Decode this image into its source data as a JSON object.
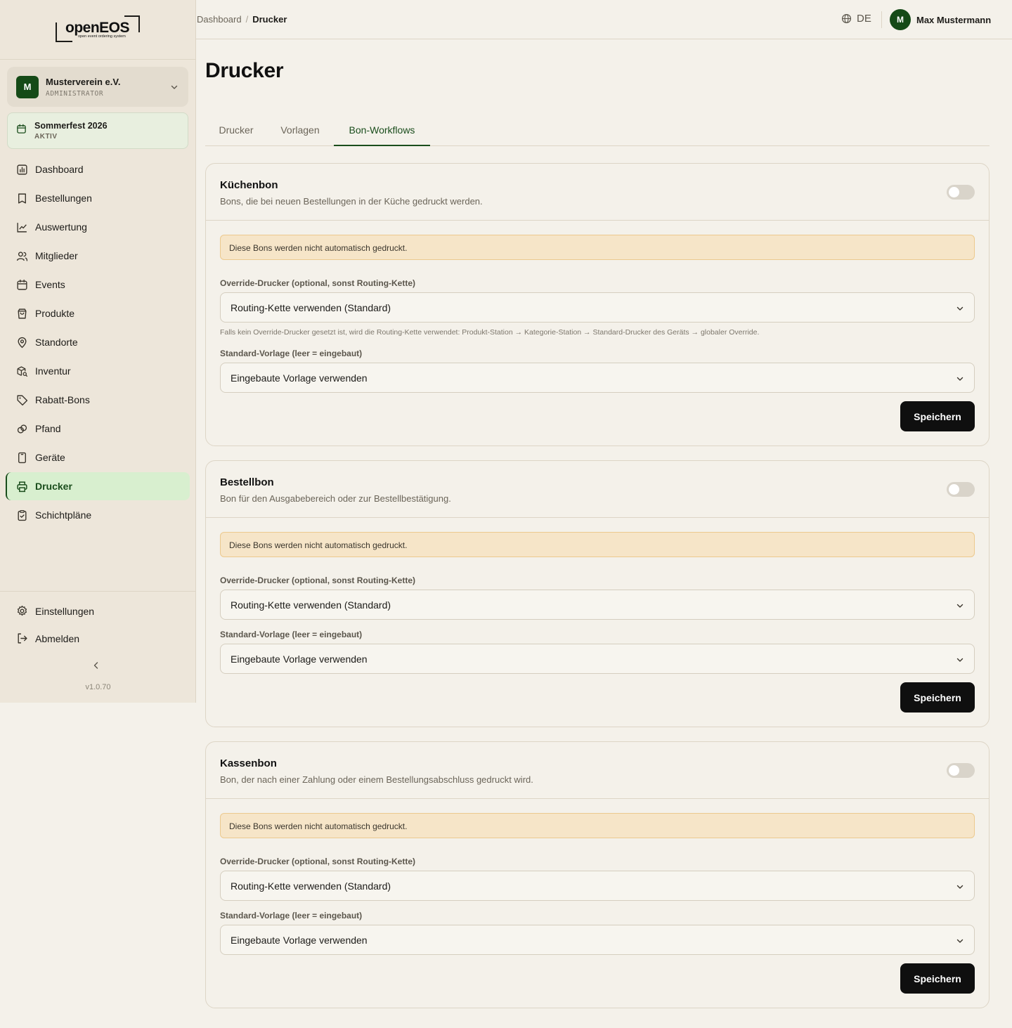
{
  "sidebar": {
    "brand": "openEOS",
    "brand_tagline": "open event ordering system",
    "org": {
      "initial": "M",
      "name": "Musterverein e.V.",
      "role": "ADMINISTRATOR"
    },
    "event": {
      "name": "Sommerfest 2026",
      "status": "AKTIV"
    },
    "items": [
      {
        "label": "Dashboard",
        "icon": "dashboard-icon"
      },
      {
        "label": "Bestellungen",
        "icon": "receipt-icon"
      },
      {
        "label": "Auswertung",
        "icon": "chart-line-icon"
      },
      {
        "label": "Mitglieder",
        "icon": "users-icon"
      },
      {
        "label": "Events",
        "icon": "calendar-icon"
      },
      {
        "label": "Produkte",
        "icon": "shopping-bag-icon"
      },
      {
        "label": "Standorte",
        "icon": "map-pin-icon"
      },
      {
        "label": "Inventur",
        "icon": "package-search-icon"
      },
      {
        "label": "Rabatt-Bons",
        "icon": "tag-icon"
      },
      {
        "label": "Pfand",
        "icon": "link-icon"
      },
      {
        "label": "Geräte",
        "icon": "tablet-icon"
      },
      {
        "label": "Drucker",
        "icon": "printer-icon",
        "active": true
      },
      {
        "label": "Schichtpläne",
        "icon": "clipboard-check-icon"
      }
    ],
    "settings_label": "Einstellungen",
    "logout_label": "Abmelden",
    "version": "v1.0.70"
  },
  "topbar": {
    "breadcrumb_root": "Dashboard",
    "breadcrumb_sep": "/",
    "breadcrumb_current": "Drucker",
    "language": "DE",
    "user_initial": "M",
    "user_name": "Max Mustermann"
  },
  "main": {
    "title": "Drucker",
    "tabs": [
      "Drucker",
      "Vorlagen",
      "Bon-Workflows"
    ],
    "active_tab": "Bon-Workflows",
    "cards": [
      {
        "title": "Küchenbon",
        "description": "Bons, die bei neuen Bestellungen in der Küche gedruckt werden.",
        "enabled": false,
        "notice": "Diese Bons werden nicht automatisch gedruckt.",
        "override_label": "Override-Drucker (optional, sonst Routing-Kette)",
        "override_value": "Routing-Kette verwenden (Standard)",
        "hint": "Falls kein Override-Drucker gesetzt ist, wird die Routing-Kette verwendet: Produkt-Station → Kategorie-Station → Standard-Drucker des Geräts → globaler Override.",
        "template_label": "Standard-Vorlage (leer = eingebaut)",
        "template_value": "Eingebaute Vorlage verwenden",
        "save_label": "Speichern"
      },
      {
        "title": "Bestellbon",
        "description": "Bon für den Ausgabebereich oder zur Bestellbestätigung.",
        "enabled": false,
        "notice": "Diese Bons werden nicht automatisch gedruckt.",
        "override_label": "Override-Drucker (optional, sonst Routing-Kette)",
        "override_value": "Routing-Kette verwenden (Standard)",
        "template_label": "Standard-Vorlage (leer = eingebaut)",
        "template_value": "Eingebaute Vorlage verwenden",
        "save_label": "Speichern"
      },
      {
        "title": "Kassenbon",
        "description": "Bon, der nach einer Zahlung oder einem Bestellungsabschluss gedruckt wird.",
        "enabled": false,
        "notice": "Diese Bons werden nicht automatisch gedruckt.",
        "override_label": "Override-Drucker (optional, sonst Routing-Kette)",
        "override_value": "Routing-Kette verwenden (Standard)",
        "template_label": "Standard-Vorlage (leer = eingebaut)",
        "template_value": "Eingebaute Vorlage verwenden",
        "save_label": "Speichern"
      }
    ]
  },
  "colors": {
    "accent": "#1a4d1c",
    "active_nav_bg": "#d8efcf",
    "notice_bg": "#f6e5c8",
    "button_bg": "#0f0f0f"
  }
}
